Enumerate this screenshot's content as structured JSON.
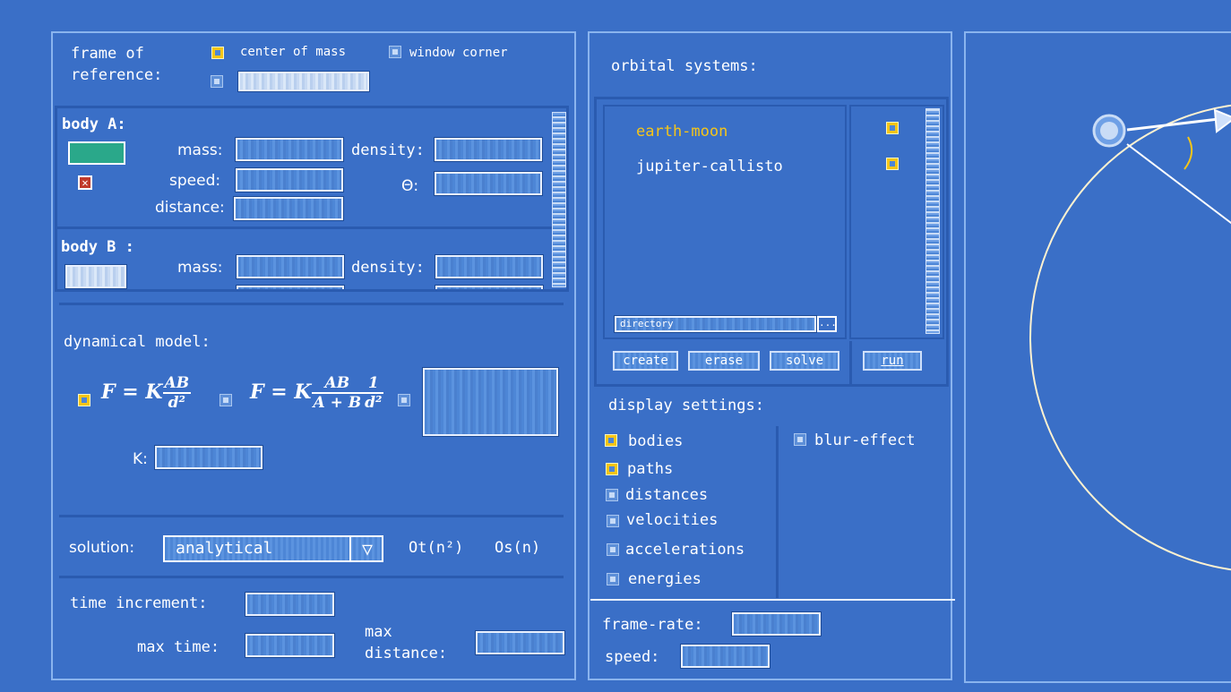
{
  "reference": {
    "title": "frame of\nreference:",
    "option1": "center of mass",
    "option2": "window corner"
  },
  "bodyA": {
    "title": "body A:",
    "mass_label": "mass:",
    "density_label": "density:",
    "speed_label": "speed:",
    "theta_label": "Θ:",
    "distance_label": "distance:",
    "color": "#2aa88a"
  },
  "bodyB": {
    "title": "body B :",
    "mass_label": "mass:",
    "density_label": "density:"
  },
  "dynamics": {
    "title": "dynamical model:",
    "formula1": {
      "lhs": "F = K",
      "num": "AB",
      "den": "d²"
    },
    "formula2": {
      "lhs": "F = K",
      "num": "AB",
      "den": "A + B",
      "num2": "1",
      "den2": "d²"
    },
    "k_label": "K:"
  },
  "solution": {
    "label": "solution:",
    "selected": "analytical",
    "time_complexity": "Ot(n²)",
    "space_complexity": "Os(n)"
  },
  "timing": {
    "time_increment_label": "time increment:",
    "max_time_label": "max time:",
    "max_distance_label": "max\ndistance:"
  },
  "orbital": {
    "title": "orbital systems:",
    "systems": [
      "earth-moon",
      "jupiter-callisto"
    ],
    "directory_label": "directory",
    "browse_label": "...",
    "create_label": "create",
    "erase_label": "erase",
    "solve_label": "solve",
    "run_label": "run"
  },
  "display": {
    "title": "display settings:",
    "options": [
      "bodies",
      "paths",
      "distances",
      "velocities",
      "accelerations",
      "energies"
    ],
    "checked": [
      true,
      true,
      false,
      false,
      false,
      false
    ],
    "blur_label": "blur-effect",
    "frame_rate_label": "frame-rate:",
    "speed_label": "speed:"
  },
  "colors": {
    "background": "#3a6fc7",
    "selected_system": "#f5c518",
    "checkbox_on": "#f5c518"
  }
}
